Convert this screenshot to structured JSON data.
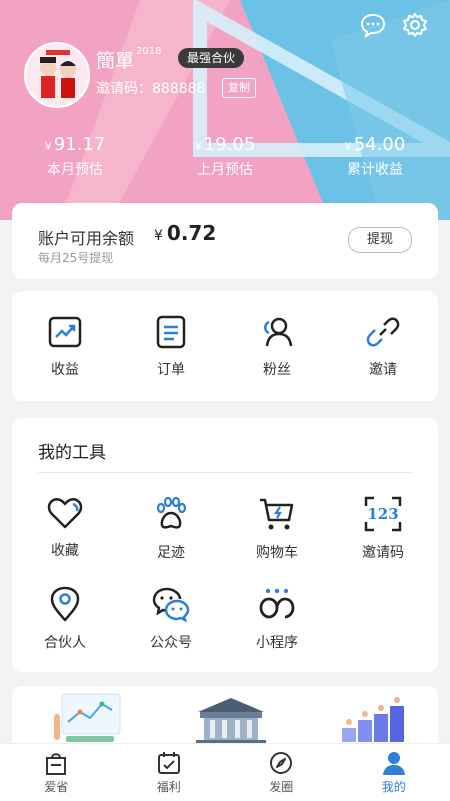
{
  "profile": {
    "name": "簡單",
    "name_sup": "2018",
    "badge": "最强合伙",
    "invite_label": "邀请码：",
    "invite_code": "888888",
    "copy_label": "复制"
  },
  "stats": [
    {
      "currency": "¥",
      "value": "91.17",
      "label": "本月预估"
    },
    {
      "currency": "¥",
      "value": "19.05",
      "label": "上月预估"
    },
    {
      "currency": "¥",
      "value": "54.00",
      "label": "累计收益"
    }
  ],
  "balance": {
    "title": "账户可用余额",
    "currency": "¥",
    "value": "0.72",
    "note": "每月25号提现",
    "withdraw_label": "提现"
  },
  "quick_links": [
    {
      "label": "收益",
      "icon": "chart-trend-icon"
    },
    {
      "label": "订单",
      "icon": "order-document-icon"
    },
    {
      "label": "粉丝",
      "icon": "fans-user-icon"
    },
    {
      "label": "邀请",
      "icon": "link-chain-icon"
    }
  ],
  "tools": {
    "title": "我的工具",
    "items": [
      {
        "label": "收藏",
        "icon": "heart-icon"
      },
      {
        "label": "足迹",
        "icon": "paw-icon"
      },
      {
        "label": "购物车",
        "icon": "cart-icon"
      },
      {
        "label": "邀请码",
        "icon": "invite-code-123-icon"
      },
      {
        "label": "合伙人",
        "icon": "location-pin-icon"
      },
      {
        "label": "公众号",
        "icon": "wechat-icon"
      },
      {
        "label": "小程序",
        "icon": "mini-program-icon"
      }
    ]
  },
  "tabbar": [
    {
      "label": "爱省",
      "icon": "shopping-bag-icon",
      "active": false
    },
    {
      "label": "福利",
      "icon": "calendar-icon",
      "active": false
    },
    {
      "label": "发圈",
      "icon": "compass-icon",
      "active": false
    },
    {
      "label": "我的",
      "icon": "user-profile-icon",
      "active": true
    }
  ],
  "colors": {
    "header_blue": "#6cc1e6",
    "header_pink": "#f2a3c1",
    "accent_blue": "#2d7fd8",
    "tool_icon_blue": "#2d7fd8"
  }
}
